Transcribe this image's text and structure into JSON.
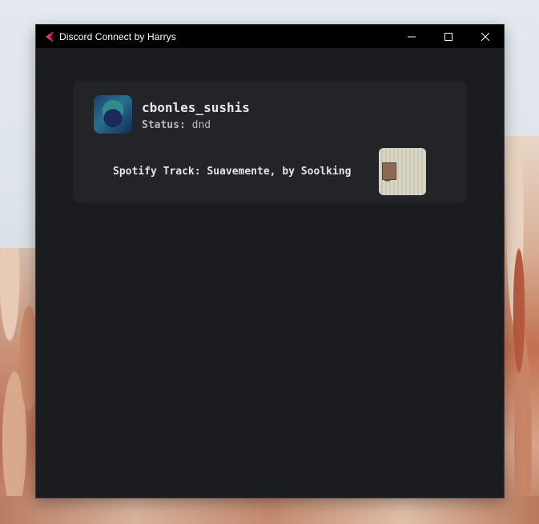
{
  "window": {
    "title": "Discord Connect by Harrys",
    "icon": "app-logo-icon",
    "controls": {
      "minimize_icon": "minimize-icon",
      "maximize_icon": "maximize-icon",
      "close_icon": "close-icon"
    }
  },
  "profile": {
    "username": "cbonles_sushis",
    "status_label": "Status:",
    "status_value": "dnd",
    "activity": "Spotify Track: Suavemente, by Soolking"
  },
  "colors": {
    "window_bg": "#1b1c1f",
    "card_bg": "#222428",
    "titlebar_bg": "#000000",
    "icon_accent": "#e2356a"
  }
}
